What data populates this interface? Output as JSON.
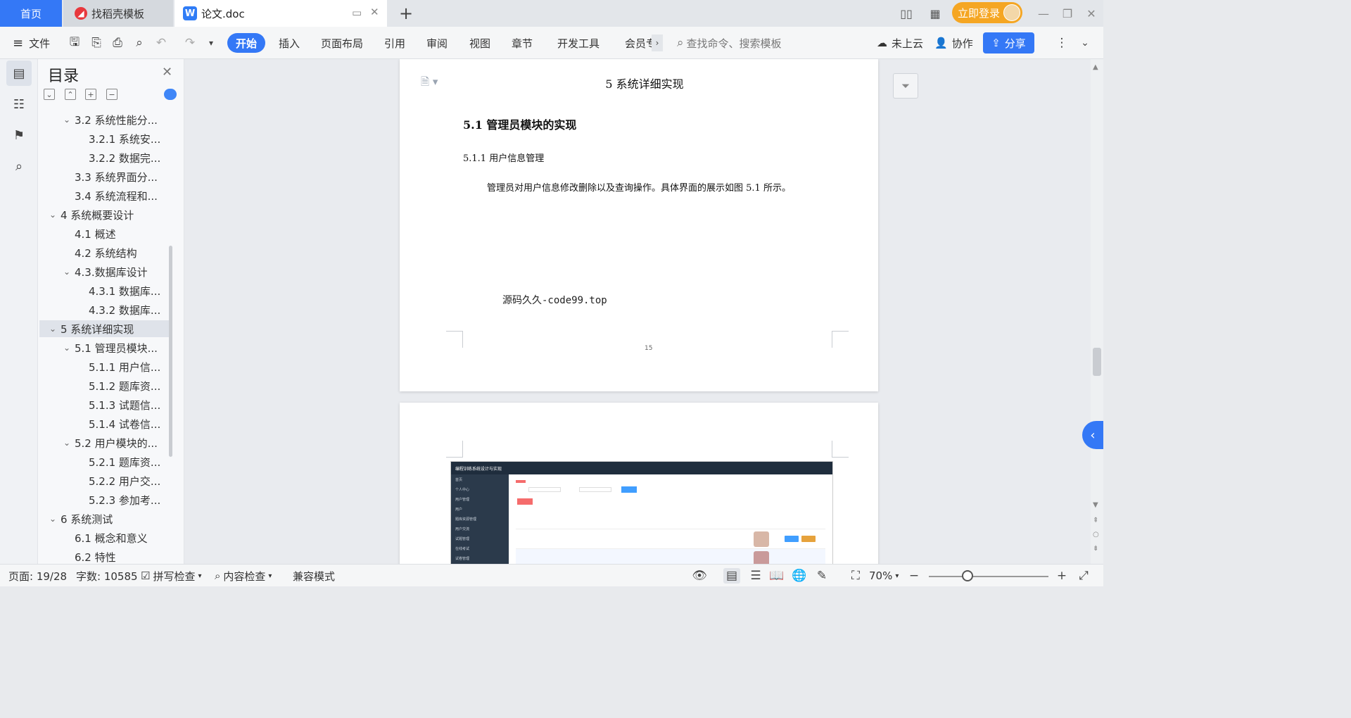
{
  "tabs": {
    "home": "首页",
    "daoke": "找稻壳模板",
    "doc": "论文.doc"
  },
  "titlebar": {
    "login": "立即登录"
  },
  "toolbar": {
    "file": "文件",
    "start": "开始",
    "insert": "插入",
    "layout": "页面布局",
    "ref": "引用",
    "review": "审阅",
    "view": "视图",
    "chapter": "章节",
    "devtools": "开发工具",
    "member": "会员专",
    "search_placeholder": "查找命令、搜索模板",
    "cloud": "未上云",
    "collab": "协作",
    "share": "分享"
  },
  "toc": {
    "title": "目录",
    "items": [
      {
        "label": "3.2 系统性能分...",
        "level": 2,
        "expanded": true
      },
      {
        "label": "3.2.1  系统安...",
        "level": 3
      },
      {
        "label": "3.2.2  数据完...",
        "level": 3
      },
      {
        "label": "3.3 系统界面分...",
        "level": 2
      },
      {
        "label": "3.4 系统流程和...",
        "level": 2
      },
      {
        "label": "4 系统概要设计",
        "level": 1,
        "expanded": true
      },
      {
        "label": "4.1 概述",
        "level": 2
      },
      {
        "label": "4.2 系统结构",
        "level": 2
      },
      {
        "label": "4.3.数据库设计",
        "level": 2,
        "expanded": true
      },
      {
        "label": "4.3.1 数据库...",
        "level": 3
      },
      {
        "label": "4.3.2 数据库...",
        "level": 3
      },
      {
        "label": "5 系统详细实现",
        "level": 1,
        "expanded": true,
        "selected": true
      },
      {
        "label": "5.1  管理员模块...",
        "level": 2,
        "expanded": true
      },
      {
        "label": "5.1.1  用户信...",
        "level": 3
      },
      {
        "label": "5.1.2  题库资...",
        "level": 3
      },
      {
        "label": "5.1.3  试题信...",
        "level": 3
      },
      {
        "label": "5.1.4  试卷信...",
        "level": 3
      },
      {
        "label": "5.2  用户模块的...",
        "level": 2,
        "expanded": true
      },
      {
        "label": "5.2.1  题库资...",
        "level": 3
      },
      {
        "label": "5.2.2  用户交...",
        "level": 3
      },
      {
        "label": "5.2.3  参加考...",
        "level": 3
      },
      {
        "label": "6 系统测试",
        "level": 1,
        "expanded": true
      },
      {
        "label": "6.1 概念和意义",
        "level": 2
      },
      {
        "label": "6.2 特性",
        "level": 2
      }
    ]
  },
  "doc": {
    "h1": "5 系统详细实现",
    "h2": "5.1  管理员模块的实现",
    "h3": "5.1.1  用户信息管理",
    "para": "管理员对用户信息修改删除以及查询操作。具体界面的展示如图 5.1 所示。",
    "code": "源码久久-code99.top",
    "page_number": "15",
    "shot_title": "编程训练系统设计与实现",
    "shot_menu": [
      "首页",
      "个人中心",
      "用户管理",
      "用户",
      "题库资源管理",
      "用户交流",
      "试题管理",
      "在线考试",
      "试卷管理"
    ]
  },
  "status": {
    "page": "页面: 19/28",
    "words": "字数: 10585",
    "spell": "拼写检查",
    "content": "内容检查",
    "compat": "兼容模式",
    "zoom": "70%"
  }
}
